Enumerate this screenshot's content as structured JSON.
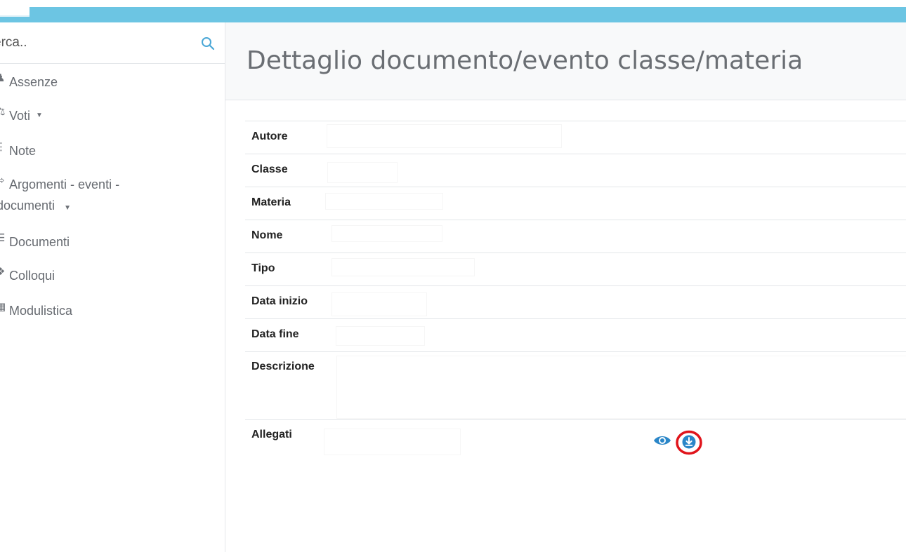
{
  "search": {
    "placeholder": "erca.."
  },
  "sidebar": {
    "items": [
      {
        "icon": "user-check-icon",
        "label": "Assenze",
        "has_caret": false
      },
      {
        "icon": "bank-icon",
        "label": "Voti",
        "has_caret": true
      },
      {
        "icon": "notes-icon",
        "label": "Note",
        "has_caret": false
      },
      {
        "icon": "arrow-icon",
        "label": "Argomenti - eventi -",
        "label2": "documenti",
        "has_caret": true
      },
      {
        "icon": "graduation-cap-icon",
        "label": "Documenti",
        "has_caret": false
      },
      {
        "icon": "handshake-icon",
        "label": "Colloqui",
        "has_caret": false
      },
      {
        "icon": "clipboard-icon",
        "label": "Modulistica",
        "has_caret": false
      }
    ],
    "caret": "▼"
  },
  "main": {
    "title": "Dettaglio documento/evento classe/materia",
    "fields": {
      "autore": "Autore",
      "classe": "Classe",
      "materia": "Materia",
      "nome": "Nome",
      "tipo": "Tipo",
      "data_inizio": "Data inizio",
      "data_fine": "Data fine",
      "descrizione": "Descrizione",
      "allegati": "Allegati"
    }
  },
  "colors": {
    "topbar": "#6cc5e3",
    "accent": "#2a86c8",
    "highlight_circle": "#e0141b"
  }
}
